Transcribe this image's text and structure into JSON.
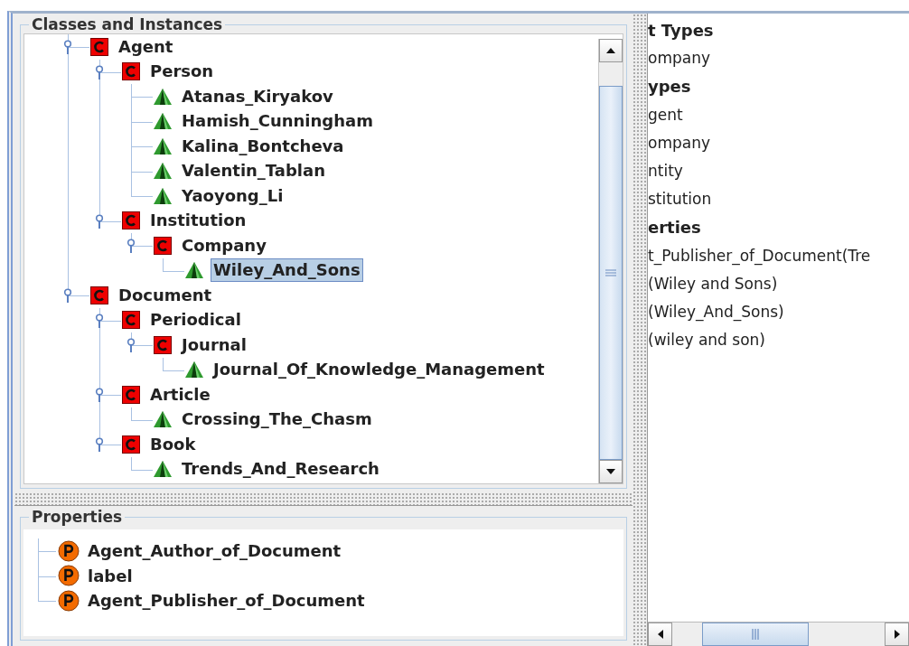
{
  "classes_panel": {
    "title": "Classes and Instances",
    "tree": [
      {
        "label": "Agent",
        "kind": "class",
        "expanded": true,
        "selected": false,
        "children": [
          {
            "label": "Person",
            "kind": "class",
            "expanded": true,
            "selected": false,
            "children": [
              {
                "label": "Atanas_Kiryakov",
                "kind": "instance",
                "selected": false
              },
              {
                "label": "Hamish_Cunningham",
                "kind": "instance",
                "selected": false
              },
              {
                "label": "Kalina_Bontcheva",
                "kind": "instance",
                "selected": false
              },
              {
                "label": "Valentin_Tablan",
                "kind": "instance",
                "selected": false
              },
              {
                "label": "Yaoyong_Li",
                "kind": "instance",
                "selected": false
              }
            ]
          },
          {
            "label": "Institution",
            "kind": "class",
            "expanded": true,
            "selected": false,
            "children": [
              {
                "label": "Company",
                "kind": "class",
                "expanded": true,
                "selected": false,
                "children": [
                  {
                    "label": "Wiley_And_Sons",
                    "kind": "instance",
                    "selected": true
                  }
                ]
              }
            ]
          }
        ]
      },
      {
        "label": "Document",
        "kind": "class",
        "expanded": true,
        "selected": false,
        "children": [
          {
            "label": "Periodical",
            "kind": "class",
            "expanded": true,
            "selected": false,
            "children": [
              {
                "label": "Journal",
                "kind": "class",
                "expanded": true,
                "selected": false,
                "children": [
                  {
                    "label": "Journal_Of_Knowledge_Management",
                    "kind": "instance",
                    "selected": false
                  }
                ]
              }
            ]
          },
          {
            "label": "Article",
            "kind": "class",
            "expanded": true,
            "selected": false,
            "children": [
              {
                "label": "Crossing_The_Chasm",
                "kind": "instance",
                "selected": false
              }
            ]
          },
          {
            "label": "Book",
            "kind": "class",
            "expanded": true,
            "selected": false,
            "children": [
              {
                "label": "Trends_And_Research",
                "kind": "instance",
                "selected": false
              }
            ]
          }
        ]
      }
    ]
  },
  "properties_panel": {
    "title": "Properties",
    "items": [
      {
        "label": "Agent_Author_of_Document"
      },
      {
        "label": "label"
      },
      {
        "label": "Agent_Publisher_of_Document"
      }
    ]
  },
  "details_panel": {
    "lines": [
      {
        "kind": "heading",
        "text": "t Types"
      },
      {
        "kind": "value",
        "text": "ompany"
      },
      {
        "kind": "heading",
        "text": "ypes"
      },
      {
        "kind": "value",
        "text": "gent"
      },
      {
        "kind": "value",
        "text": "ompany"
      },
      {
        "kind": "value",
        "text": "ntity"
      },
      {
        "kind": "value",
        "text": "stitution"
      },
      {
        "kind": "heading",
        "text": "erties"
      },
      {
        "kind": "value",
        "text": "t_Publisher_of_Document(Tre"
      },
      {
        "kind": "value",
        "text": "(Wiley and Sons)"
      },
      {
        "kind": "value",
        "text": "(Wiley_And_Sons)"
      },
      {
        "kind": "value",
        "text": "(wiley and son)"
      }
    ]
  }
}
